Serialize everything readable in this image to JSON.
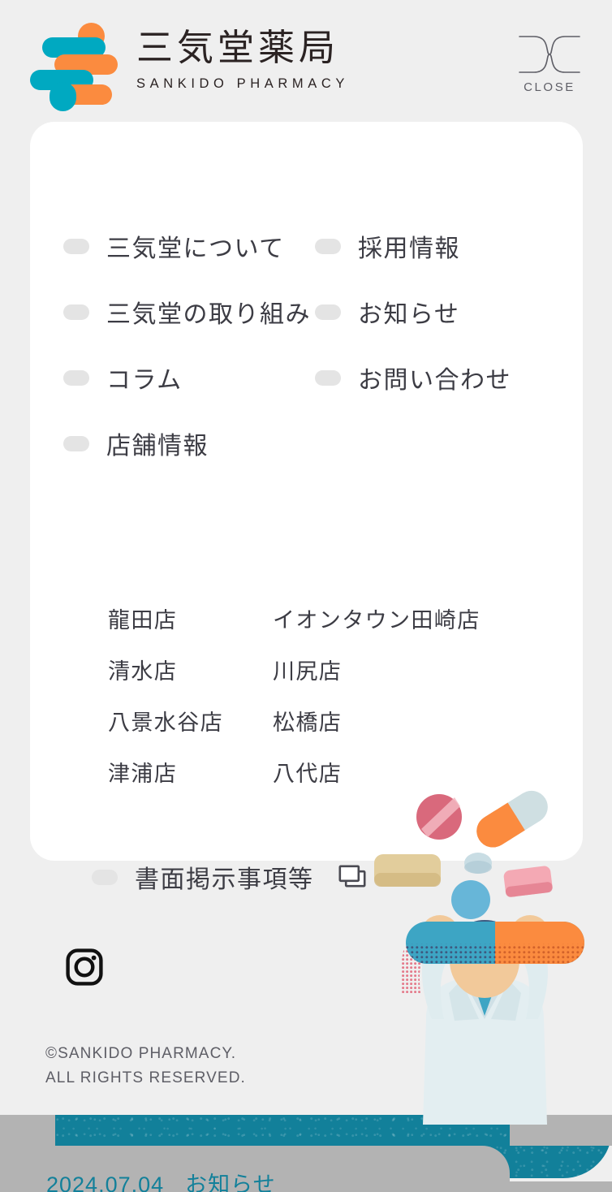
{
  "header": {
    "logo_mark_name": "sankido-logo-mark",
    "brand_ja": "三気堂薬局",
    "brand_en": "SANKIDO PHARMACY",
    "close_label": "CLOSE"
  },
  "nav": {
    "rows": [
      {
        "left": {
          "label": "三気堂について",
          "bullet": true
        },
        "right": {
          "label": "採用情報",
          "bullet": true
        }
      },
      {
        "left": {
          "label": "三気堂の取り組み",
          "bullet": true
        },
        "right": {
          "label": "お知らせ",
          "bullet": true
        }
      },
      {
        "left": {
          "label": "コラム",
          "bullet": true
        },
        "right": {
          "label": "お問い合わせ",
          "bullet": true
        }
      },
      {
        "left": {
          "label": "店舗情報",
          "bullet": true
        },
        "right": {
          "label": "",
          "bullet": false
        }
      }
    ]
  },
  "stores": [
    {
      "a": "龍田店",
      "b": "イオンタウン田崎店"
    },
    {
      "a": "清水店",
      "b": "川尻店"
    },
    {
      "a": "八景水谷店",
      "b": "松橋店"
    },
    {
      "a": "津浦店",
      "b": "八代店"
    }
  ],
  "document_link": {
    "label": "書面掲示事項等",
    "icon": "external-window-icon"
  },
  "footer": {
    "instagram_icon": "instagram-icon",
    "copyright_line1": "©SANKIDO PHARMACY.",
    "copyright_line2": "ALL RIGHTS RESERVED."
  },
  "background_page": {
    "news_date": "2024.07.04",
    "news_category": "お知らせ"
  },
  "colors": {
    "page_bg": "#efefef",
    "card_bg": "#ffffff",
    "text": "#3c3c44",
    "muted_text": "#5e5e66",
    "bullet": "#e4e4e4",
    "brand_teal": "#00a9c1",
    "brand_orange": "#fb8b3f",
    "band_teal": "#12809a",
    "overlay_gray": "#b3b3b3"
  }
}
